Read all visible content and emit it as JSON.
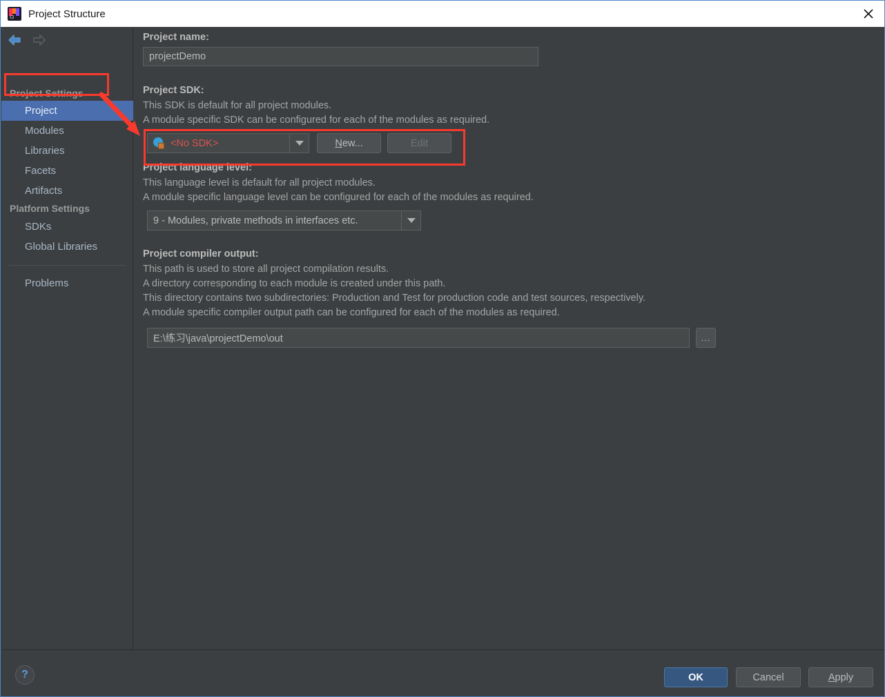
{
  "window": {
    "title": "Project Structure",
    "logo_icon": "intellij-idea-logo-icon",
    "close_icon": "close-icon"
  },
  "sidebar": {
    "back_icon": "back-arrow-icon",
    "forward_icon": "forward-arrow-icon",
    "groups": [
      {
        "label": "Project Settings"
      },
      {
        "label": "Platform Settings"
      }
    ],
    "items": [
      {
        "label": "Project",
        "selected": true
      },
      {
        "label": "Modules",
        "selected": false
      },
      {
        "label": "Libraries",
        "selected": false
      },
      {
        "label": "Facets",
        "selected": false
      },
      {
        "label": "Artifacts",
        "selected": false
      },
      {
        "label": "SDKs",
        "selected": false
      },
      {
        "label": "Global Libraries",
        "selected": false
      },
      {
        "label": "Problems",
        "selected": false
      }
    ]
  },
  "main": {
    "project_name": {
      "label": "Project name:",
      "value": "projectDemo"
    },
    "project_sdk": {
      "label": "Project SDK:",
      "desc_line1": "This SDK is default for all project modules.",
      "desc_line2": "A module specific SDK can be configured for each of the modules as required.",
      "selected": "<No SDK>",
      "sdk_icon": "sdk-module-icon",
      "dropdown_icon": "chevron-down-icon",
      "new_button": "New...",
      "new_button_mnemonic": "N",
      "edit_button": "Edit",
      "edit_disabled": true
    },
    "language_level": {
      "label": "Project language level:",
      "desc_line1": "This language level is default for all project modules.",
      "desc_line2": "A module specific language level can be configured for each of the modules as required.",
      "selected": "9 - Modules, private methods in interfaces etc.",
      "dropdown_icon": "chevron-down-icon"
    },
    "compiler_output": {
      "label": "Project compiler output:",
      "desc_line1": "This path is used to store all project compilation results.",
      "desc_line2": "A directory corresponding to each module is created under this path.",
      "desc_line3": "This directory contains two subdirectories: Production and Test for production code and test sources, respectively.",
      "desc_line4": "A module specific compiler output path can be configured for each of the modules as required.",
      "value": "E:\\练习\\java\\projectDemo\\out",
      "browse_button": "...",
      "browse_icon": "browse-folder-icon"
    }
  },
  "footer": {
    "help_label": "?",
    "help_icon": "help-icon",
    "ok_label": "OK",
    "cancel_label": "Cancel",
    "apply_label": "Apply",
    "apply_mnemonic": "A"
  },
  "annotations": {
    "highlight_color": "#f83a2e",
    "project_item_box": "highlight-box-project",
    "sdk_row_box": "highlight-box-project-sdk",
    "arrow": "pointer-arrow"
  },
  "colors": {
    "background": "#3c3f41",
    "selection": "#4b6eaf",
    "accent": "#365880",
    "error_text": "#d9544f",
    "annotation": "#f83a2e"
  }
}
